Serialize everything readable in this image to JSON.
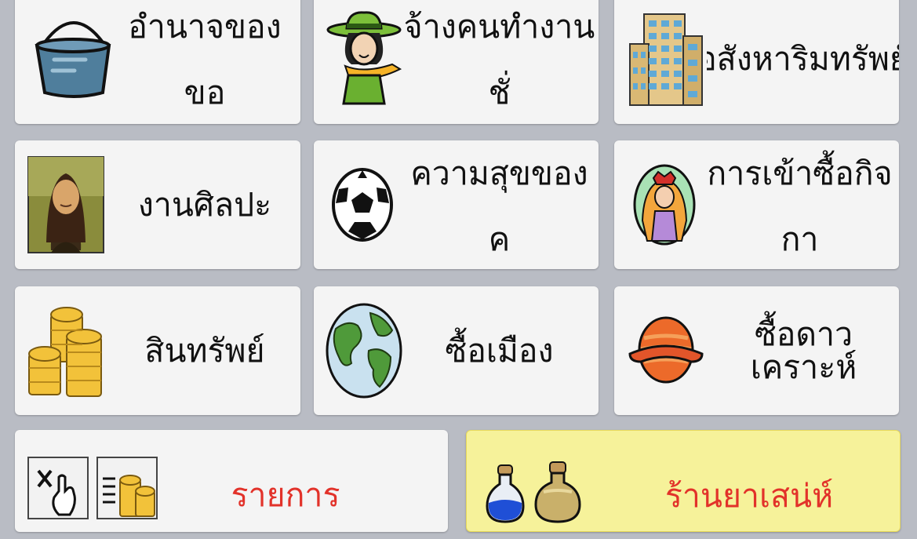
{
  "menu": {
    "items": [
      {
        "id": "power-to-beg",
        "label": "อำนาจของขอ\nทาน",
        "icon": "bucket-icon"
      },
      {
        "id": "hire-temporary-workers",
        "label": "จ้างคนทำงานชั่\nวคราว",
        "icon": "man-with-hat-icon"
      },
      {
        "id": "real-estate",
        "label": "อสังหาริมทรัพย์",
        "icon": "building-icon"
      },
      {
        "id": "artwork",
        "label": "งานศิลปะ",
        "icon": "mona-lisa-icon"
      },
      {
        "id": "temporary-worker-happiness",
        "label": "ความสุขของค\nนทำงานชั่วครา",
        "icon": "soccer-ball-icon"
      },
      {
        "id": "company-acquisition",
        "label": "การเข้าซื้อกิจกา\nรขององค์กร",
        "icon": "person-portrait-icon"
      },
      {
        "id": "assets",
        "label": "สินทรัพย์",
        "icon": "gold-coins-icon"
      },
      {
        "id": "buy-city",
        "label": "ซื้อเมือง",
        "icon": "globe-icon"
      },
      {
        "id": "buy-planet",
        "label": "ซื้อดาวเคราะห์",
        "icon": "planet-icon"
      }
    ],
    "list": {
      "label": "รายการ",
      "icons": [
        "close-cursor-icon",
        "coins-list-icon"
      ]
    },
    "shop": {
      "label": "ร้านยาเสน่ห์",
      "icons": [
        "blue-potion-icon",
        "gold-potion-icon"
      ]
    }
  },
  "colors": {
    "background": "#b9bcc4",
    "card": "#f4f4f4",
    "shop": "#f6f29a",
    "accent_text": "#e2322a"
  }
}
